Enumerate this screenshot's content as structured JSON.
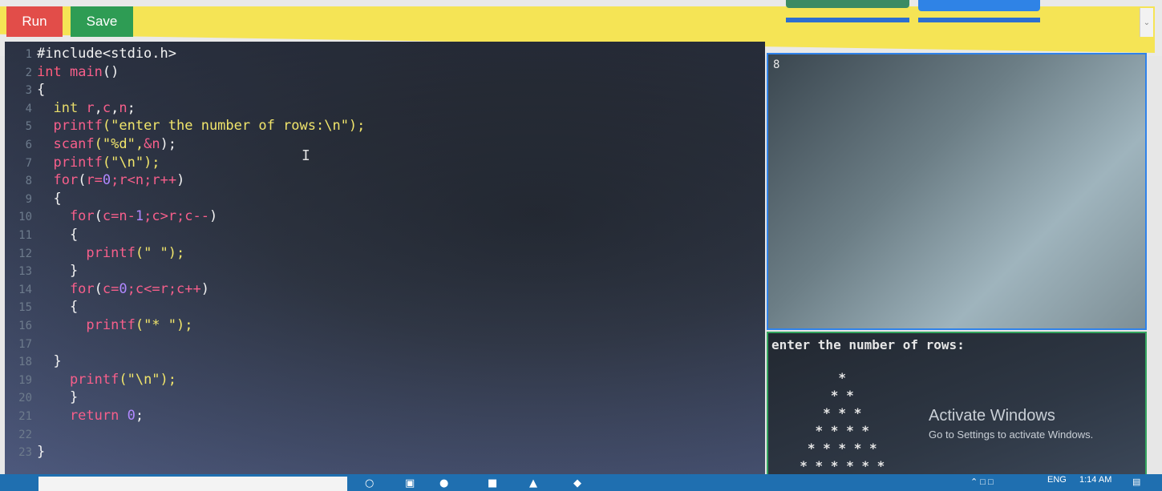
{
  "toolbar": {
    "run_label": "Run",
    "save_label": "Save"
  },
  "editor": {
    "lines": [
      {
        "n": "1",
        "tokens": [
          {
            "c": "#include<stdio.h>",
            "t": "var"
          }
        ]
      },
      {
        "n": "2",
        "tokens": [
          {
            "c": "int ",
            "t": "ty"
          },
          {
            "c": "main",
            "t": "kw"
          },
          {
            "c": "()",
            "t": "var"
          }
        ]
      },
      {
        "n": "3",
        "tokens": [
          {
            "c": "{",
            "t": "var"
          }
        ]
      },
      {
        "n": "4",
        "tokens": [
          {
            "c": "  int ",
            "t": "fn"
          },
          {
            "c": "r",
            "t": "kw"
          },
          {
            "c": ",",
            "t": "var"
          },
          {
            "c": "c",
            "t": "kw"
          },
          {
            "c": ",",
            "t": "var"
          },
          {
            "c": "n",
            "t": "kw"
          },
          {
            "c": ";",
            "t": "var"
          }
        ]
      },
      {
        "n": "5",
        "tokens": [
          {
            "c": "  printf",
            "t": "kw"
          },
          {
            "c": "(\"enter the number of rows:\\n\");",
            "t": "str"
          }
        ]
      },
      {
        "n": "6",
        "tokens": [
          {
            "c": "  scanf",
            "t": "kw"
          },
          {
            "c": "(\"%d\",",
            "t": "str"
          },
          {
            "c": "&n",
            "t": "kw"
          },
          {
            "c": ");",
            "t": "var"
          }
        ]
      },
      {
        "n": "7",
        "tokens": [
          {
            "c": "  printf",
            "t": "kw"
          },
          {
            "c": "(\"\\n\");",
            "t": "str"
          }
        ]
      },
      {
        "n": "8",
        "tokens": [
          {
            "c": "  for",
            "t": "kw"
          },
          {
            "c": "(",
            "t": "var"
          },
          {
            "c": "r=",
            "t": "kw"
          },
          {
            "c": "0",
            "t": "num"
          },
          {
            "c": ";r<n;r++",
            "t": "kw"
          },
          {
            "c": ")",
            "t": "var"
          }
        ]
      },
      {
        "n": "9",
        "tokens": [
          {
            "c": "  {",
            "t": "var"
          }
        ]
      },
      {
        "n": "10",
        "tokens": [
          {
            "c": "    for",
            "t": "kw"
          },
          {
            "c": "(",
            "t": "var"
          },
          {
            "c": "c=n-",
            "t": "kw"
          },
          {
            "c": "1",
            "t": "num"
          },
          {
            "c": ";c>r;c--",
            "t": "kw"
          },
          {
            "c": ")",
            "t": "var"
          }
        ]
      },
      {
        "n": "11",
        "tokens": [
          {
            "c": "    {",
            "t": "var"
          }
        ]
      },
      {
        "n": "12",
        "tokens": [
          {
            "c": "      printf",
            "t": "kw"
          },
          {
            "c": "(\" \");",
            "t": "str"
          }
        ]
      },
      {
        "n": "13",
        "tokens": [
          {
            "c": "    }",
            "t": "var"
          }
        ]
      },
      {
        "n": "14",
        "tokens": [
          {
            "c": "    for",
            "t": "kw"
          },
          {
            "c": "(",
            "t": "var"
          },
          {
            "c": "c=",
            "t": "kw"
          },
          {
            "c": "0",
            "t": "num"
          },
          {
            "c": ";c<=r;c++",
            "t": "kw"
          },
          {
            "c": ")",
            "t": "var"
          }
        ]
      },
      {
        "n": "15",
        "tokens": [
          {
            "c": "    {",
            "t": "var"
          }
        ]
      },
      {
        "n": "16",
        "tokens": [
          {
            "c": "      printf",
            "t": "kw"
          },
          {
            "c": "(\"* \");",
            "t": "str"
          }
        ]
      },
      {
        "n": "17",
        "tokens": []
      },
      {
        "n": "18",
        "tokens": [
          {
            "c": "  }",
            "t": "var"
          }
        ]
      },
      {
        "n": "19",
        "tokens": [
          {
            "c": "    printf",
            "t": "kw"
          },
          {
            "c": "(\"\\n\");",
            "t": "str"
          }
        ]
      },
      {
        "n": "20",
        "tokens": [
          {
            "c": "    }",
            "t": "var"
          }
        ]
      },
      {
        "n": "21",
        "tokens": [
          {
            "c": "    return ",
            "t": "kw"
          },
          {
            "c": "0",
            "t": "num"
          },
          {
            "c": ";",
            "t": "var"
          }
        ]
      },
      {
        "n": "22",
        "tokens": []
      },
      {
        "n": "23",
        "tokens": [
          {
            "c": "}",
            "t": "var"
          }
        ]
      }
    ]
  },
  "input_pane": {
    "value": "8"
  },
  "output_pane": {
    "prompt": "enter the number of rows:",
    "pyramid": [
      "       *",
      "      * *",
      "     * * *",
      "    * * * *",
      "   * * * * *",
      "  * * * * * *"
    ]
  },
  "watermark": {
    "title": "Activate Windows",
    "subtitle": "Go to Settings to activate Windows."
  },
  "taskbar": {
    "language": "ENG",
    "time": "1:14 AM"
  }
}
